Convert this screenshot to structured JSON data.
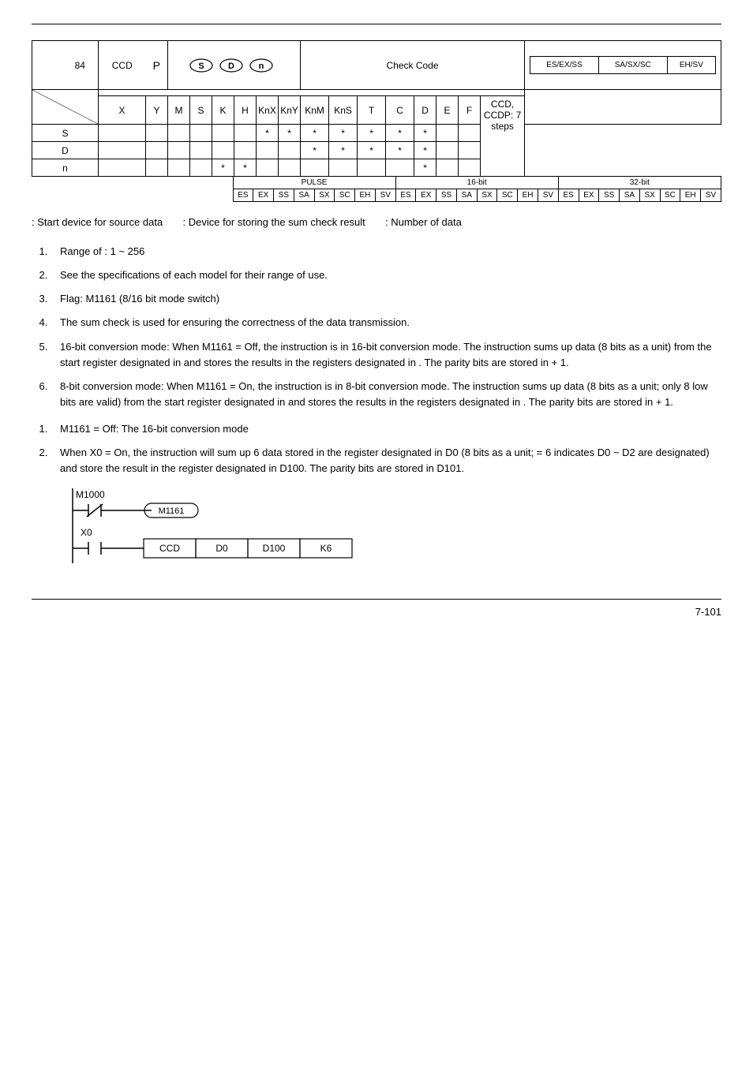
{
  "header": {},
  "table1": {
    "api": "84",
    "mnemonic": "CCD",
    "p": "P",
    "func": "Check Code",
    "controllers": [
      "ES/EX/SS",
      "SA/SX/SC",
      "EH/SV"
    ],
    "type_head": "",
    "bit_head": "",
    "word_head": "",
    "steps_head": "",
    "cols": [
      "X",
      "Y",
      "M",
      "S",
      "K",
      "H",
      "KnX",
      "KnY",
      "KnM",
      "KnS",
      "T",
      "C",
      "D",
      "E",
      "F"
    ],
    "rows": [
      {
        "label": "S",
        "marks": [
          0,
          0,
          0,
          0,
          0,
          0,
          1,
          1,
          1,
          1,
          1,
          1,
          1,
          0,
          0
        ]
      },
      {
        "label": "D",
        "marks": [
          0,
          0,
          0,
          0,
          0,
          0,
          0,
          0,
          1,
          1,
          1,
          1,
          1,
          0,
          0
        ]
      },
      {
        "label": "n",
        "marks": [
          0,
          0,
          0,
          0,
          1,
          1,
          0,
          0,
          0,
          0,
          0,
          0,
          1,
          0,
          0
        ]
      }
    ],
    "steps": "CCD, CCDP: 7 steps",
    "pulse": "PULSE",
    "bit16": "16-bit",
    "bit32": "32-bit",
    "pcols": [
      "ES",
      "EX",
      "SS",
      "SA",
      "SX",
      "SC",
      "EH",
      "SV",
      "ES",
      "EX",
      "SS",
      "SA",
      "SX",
      "SC",
      "EH",
      "SV",
      "ES",
      "EX",
      "SS",
      "SA",
      "SX",
      "SC",
      "EH",
      "SV"
    ]
  },
  "operands_line": {
    "a": ": Start device for source data",
    "b": ": Device for storing the sum check result",
    "c": ": Number of data"
  },
  "exp_items": [
    "Range of  : 1 ~ 256",
    "See the specifications of each model for their range of use.",
    "Flag: M1161 (8/16 bit mode switch)",
    "The sum check is used for ensuring the correctness of the data transmission.",
    "16-bit conversion mode: When M1161 = Off, the instruction is in 16-bit conversion mode. The instruction sums up  data (8 bits as a unit) from the start register designated in  and stores the results in the registers designated in  . The parity bits are stored in   + 1.",
    "8-bit conversion mode: When M1161 = On, the instruction is in 8-bit conversion mode. The instruction sums up  data (8 bits as a unit; only 8 low bits are valid) from the start register designated in  and stores the results in the registers designated in  . The parity bits are stored in   + 1."
  ],
  "prog_items": [
    "M1161 = Off: The 16-bit conversion mode",
    "When X0 = On, the instruction will sum up 6 data stored in the register designated in D0 (8 bits as a unit;   = 6 indicates D0 ~ D2 are designated) and store the result in the register designated in D100. The parity bits are stored in D101."
  ],
  "ladder": {
    "m1000": "M1000",
    "m1161": "M1161",
    "x0": "X0",
    "ccd": "CCD",
    "d0": "D0",
    "d100": "D100",
    "k6": "K6"
  },
  "footer": {
    "page": "7-101"
  }
}
